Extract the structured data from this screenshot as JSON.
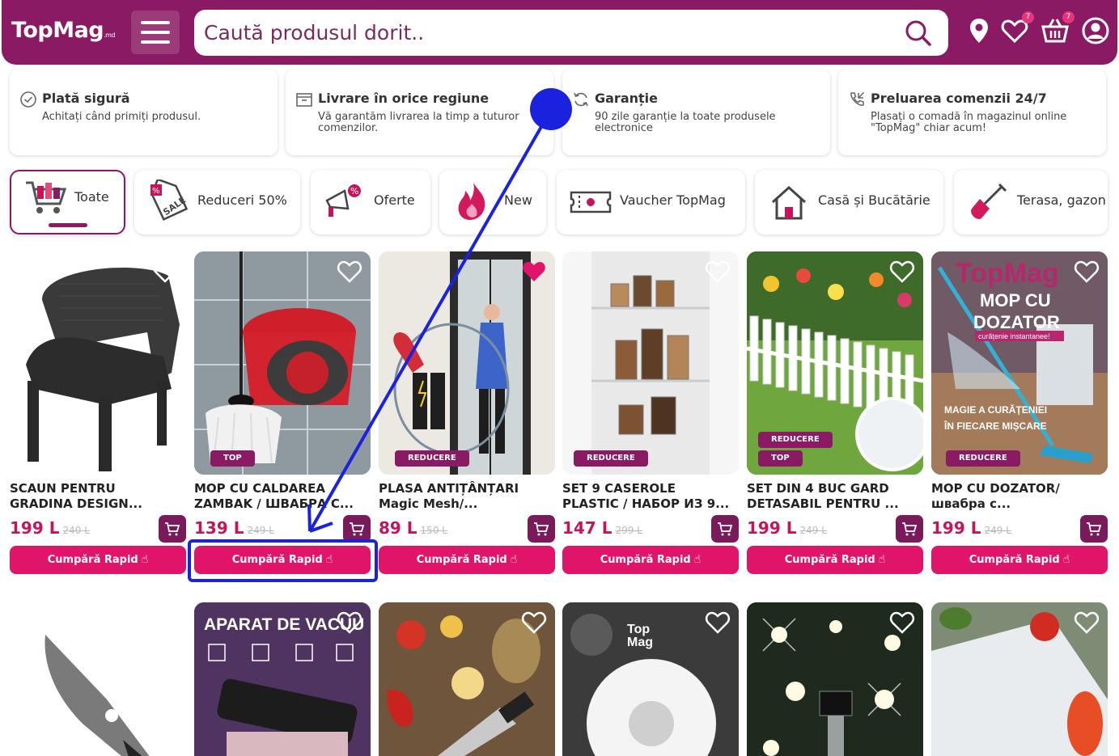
{
  "header": {
    "logo": "TopMag",
    "logo_suffix": ".md",
    "search_placeholder": "Caută produsul dorit..",
    "wishlist_count": "7",
    "cart_count": "7"
  },
  "info_cards": [
    {
      "title": "Plată sigură",
      "desc": "Achitați când primiți produsul."
    },
    {
      "title": "Livrare în orice regiune",
      "desc": "Vă garantăm livrarea la timp a tuturor comenzilor."
    },
    {
      "title": "Garanție",
      "desc": "90 zile garanție la toate produsele electronice"
    },
    {
      "title": "Preluarea comenzii 24/7",
      "desc": "Plasați o comadă în magazinul online \"TopMag\" chiar acum!"
    }
  ],
  "categories": [
    {
      "label": "Toate"
    },
    {
      "label": "Reduceri 50%"
    },
    {
      "label": "Oferte"
    },
    {
      "label": "New"
    },
    {
      "label": "Vaucher TopMag"
    },
    {
      "label": "Casă și Bucătărie"
    },
    {
      "label": "Terasa, gazon"
    }
  ],
  "products": [
    {
      "title1": "SCAUN PENTRU",
      "title2": "GRADINA DESIGN...",
      "price": "199 L",
      "old": "240 L",
      "buy": "Cumpără Rapid",
      "tags": []
    },
    {
      "title1": "MOP CU CALDAREA",
      "title2": "ZAMBAK / ШВАБРА С...",
      "price": "139 L",
      "old": "249 L",
      "buy": "Cumpără Rapid",
      "tags": [
        "TOP"
      ]
    },
    {
      "title1": "PLASA ANTIȚÂNȚARI",
      "title2": "Magic Mesh/...",
      "price": "89 L",
      "old": "150 L",
      "buy": "Cumpără Rapid",
      "tags": [
        "REDUCERE"
      ]
    },
    {
      "title1": "SET 9 CASEROLE",
      "title2": "PLASTIC / НАБОР ИЗ 9...",
      "price": "147 L",
      "old": "299 L",
      "buy": "Cumpără Rapid",
      "tags": [
        "REDUCERE"
      ]
    },
    {
      "title1": "SET DIN 4 BUC GARD",
      "title2": "DETASABIL PENTRU ...",
      "price": "199 L",
      "old": "249 L",
      "buy": "Cumpără Rapid",
      "tags": [
        "REDUCERE",
        "TOP"
      ]
    },
    {
      "title1": "MOP CU DOZATOR/",
      "title2": "швабра с...",
      "price": "199 L",
      "old": "249 L",
      "buy": "Cumpără Rapid",
      "tags": [
        "REDUCERE"
      ]
    }
  ],
  "product_image_text": {
    "mop_dozator_brand": "TopMag",
    "mop_dozator_title1": "MOP CU",
    "mop_dozator_title2": "DOZATOR",
    "mop_dozator_sub": "curățenie instantanee!",
    "mop_dozator_tag1": "MAGIE A CURĂȚENIEI",
    "mop_dozator_tag2": "ÎN FIECARE MIȘCARE",
    "vacuum_title": "APARAT DE VACUU",
    "mop_head_brand1": "Top",
    "mop_head_brand2": "Mag"
  },
  "colors": {
    "brand": "#8a1a63",
    "accent": "#e0156a",
    "price": "#c4155c",
    "annotation": "#1a22e0"
  }
}
